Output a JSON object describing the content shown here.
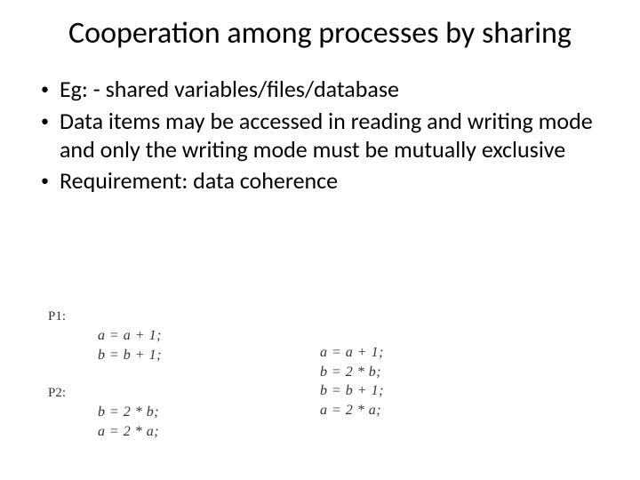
{
  "title": "Cooperation among processes by sharing",
  "bullets": [
    "Eg: - shared variables/files/database",
    "Data items may be accessed in reading and writing mode and only the writing mode must be mutually exclusive",
    "Requirement: data coherence"
  ],
  "code": {
    "p1_label": "P1:",
    "p1_lines": [
      "a = a + 1;",
      "b = b + 1;"
    ],
    "p2_label": "P2:",
    "p2_lines": [
      "b = 2 * b;",
      "a = 2 * a;"
    ],
    "right_lines": [
      "a = a + 1;",
      "b = 2 * b;",
      "b = b + 1;",
      "a = 2 * a;"
    ]
  }
}
